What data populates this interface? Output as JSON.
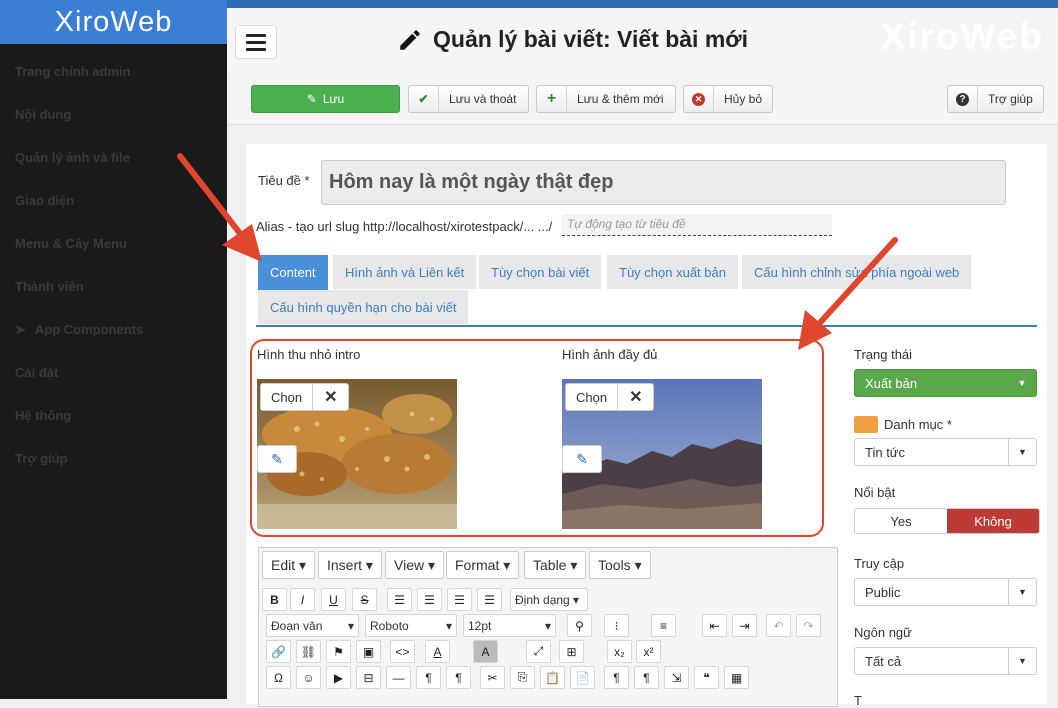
{
  "brand": {
    "name": "XiroWeb",
    "watermark": "XiroWeb"
  },
  "sidebar": {
    "items": [
      {
        "label": "Trang chính admin",
        "icon": ""
      },
      {
        "label": "Nội dung",
        "icon": ""
      },
      {
        "label": "Quản lý ảnh và file",
        "icon": ""
      },
      {
        "label": "Giao diện",
        "icon": ""
      },
      {
        "label": "Menu & Cây Menu",
        "icon": ""
      },
      {
        "label": "Thành viên",
        "icon": ""
      },
      {
        "label": "App Components",
        "icon": "rocket-icon"
      },
      {
        "label": "Cài đặt",
        "icon": ""
      },
      {
        "label": "Hệ thống",
        "icon": ""
      },
      {
        "label": "Trợ giúp",
        "icon": ""
      }
    ]
  },
  "header": {
    "title": "Quản lý bài viết: Viết bài mới"
  },
  "toolbar": {
    "save": "Lưu",
    "save_close": "Lưu và thoát",
    "save_new": "Lưu & thêm mới",
    "cancel": "Hủy bỏ",
    "help": "Trợ giúp"
  },
  "form": {
    "title_label": "Tiêu đề *",
    "title_value": "Hôm nay là một ngày thật đẹp",
    "alias_label": "Alias - tạo url slug http://localhost/xirotestpack/... .../",
    "alias_placeholder": "Tự động tạo từ tiêu đề"
  },
  "tabs": [
    "Content",
    "Hình ảnh và Liên kết",
    "Tùy chọn bài viết",
    "Tùy chọn xuất bản",
    "Cấu hình chỉnh sửa phía ngoài web",
    "Cấu hình quyền hạn cho bài viết"
  ],
  "images": {
    "intro_label": "Hình thu nhỏ intro",
    "full_label": "Hình ảnh đầy đủ",
    "choose": "Chọn"
  },
  "editor": {
    "menus": [
      "Edit",
      "Insert",
      "View",
      "Format",
      "Table",
      "Tools"
    ],
    "format_select": "Định dạng",
    "block_select": "Đoạn văn",
    "font_select": "Roboto",
    "size_select": "12pt"
  },
  "side": {
    "status_label": "Trạng thái",
    "status_value": "Xuất bản",
    "category_label": "Danh mục *",
    "category_value": "Tin tức",
    "featured_label": "Nổi bật",
    "featured_yes": "Yes",
    "featured_no": "Không",
    "access_label": "Truy cập",
    "access_value": "Public",
    "language_label": "Ngôn ngữ",
    "language_value": "Tất cả",
    "next_label": "T"
  },
  "colors": {
    "sidebar": "#1a1a1a",
    "header_bar": "#2f6db5",
    "logo_bg": "#3a7fd5",
    "save": "#4caf50",
    "danger": "#bd3a35",
    "annotation": "#e0452d",
    "link": "#3a7ebf"
  }
}
